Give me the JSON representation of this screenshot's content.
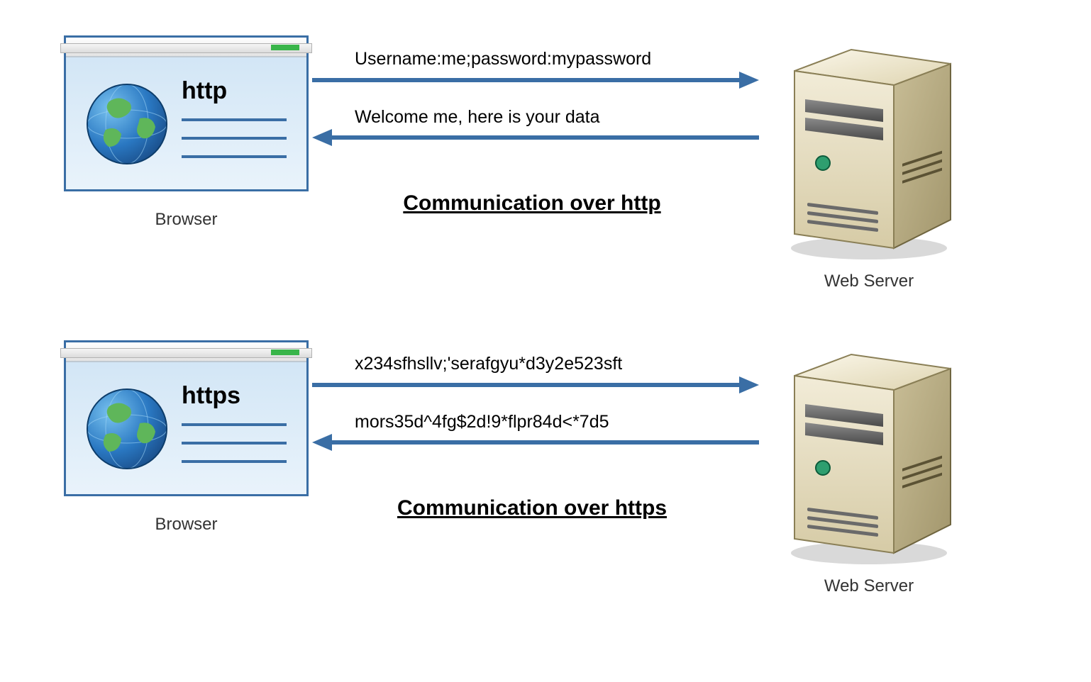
{
  "sections": {
    "http": {
      "browser_label": "Browser",
      "protocol": "http",
      "request_text": "Username:me;password:mypassword",
      "response_text": "Welcome me, here is your data",
      "title": "Communication over http",
      "server_label": "Web Server"
    },
    "https": {
      "browser_label": "Browser",
      "protocol": "https",
      "request_text": "x234sfhsllv;'serafgyu*d3y2e523sft",
      "response_text": "mors35d^4fg$2d!9*flpr84d<*7d5",
      "title": "Communication over https",
      "server_label": "Web Server"
    }
  },
  "colors": {
    "arrow": "#3a6ea5",
    "browser_border": "#3a6ea5"
  }
}
